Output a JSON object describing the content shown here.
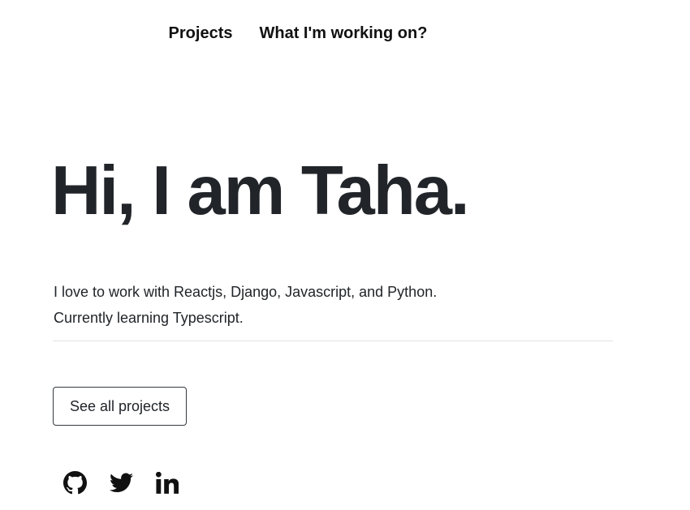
{
  "nav": {
    "projects_label": "Projects",
    "working_label": "What I'm working on?"
  },
  "hero": {
    "title": "Hi, I am Taha."
  },
  "bio": {
    "line1": "I love to work with Reactjs, Django, Javascript, and Python.",
    "line2": "Currently learning Typescript."
  },
  "cta": {
    "label": "See all projects"
  },
  "socials": [
    {
      "icon": "github-icon"
    },
    {
      "icon": "twitter-icon"
    },
    {
      "icon": "linkedin-icon"
    }
  ],
  "colors": {
    "text": "#212529",
    "divider": "#dee2e6",
    "button_border": "#343a40",
    "background": "#ffffff"
  }
}
